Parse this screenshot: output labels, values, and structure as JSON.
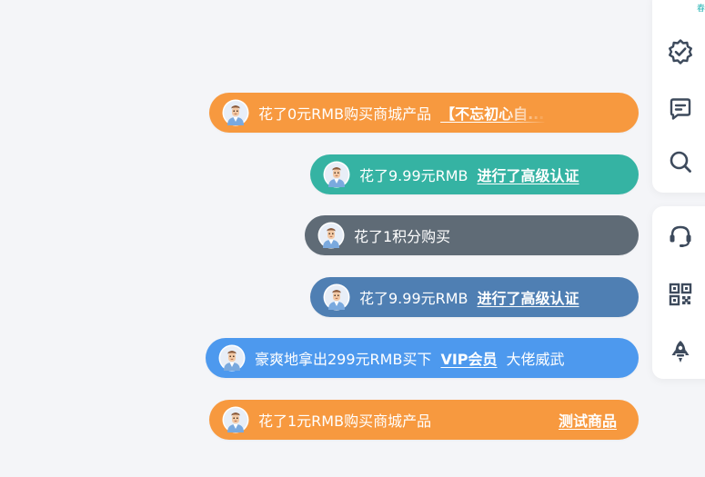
{
  "messages": [
    {
      "text": "花了0元RMB购买商城产品",
      "link": "【不忘初心自..."
    },
    {
      "text": "花了9.99元RMB",
      "link": "进行了高级认证"
    },
    {
      "text": "花了1积分购买"
    },
    {
      "text": "花了9.99元RMB",
      "link": "进行了高级认证"
    },
    {
      "text": "豪爽地拿出299元RMB买下",
      "link": "VIP会员",
      "tail": "大佬威武"
    },
    {
      "text": "花了1元RMB购买商城产品",
      "link": "测试商品"
    }
  ],
  "pill_colors": [
    "#f7993f",
    "#35b3a3",
    "#5f6b76",
    "#4f7fb3",
    "#4d99ee",
    "#f7993f"
  ],
  "toolbar": {
    "icons": [
      "verified-badge-icon",
      "chat-message-icon",
      "search-icon",
      "customer-service-icon",
      "qr-code-icon",
      "rocket-icon"
    ],
    "icon_color": "#3d4a5c"
  },
  "corner_glyph": "春"
}
